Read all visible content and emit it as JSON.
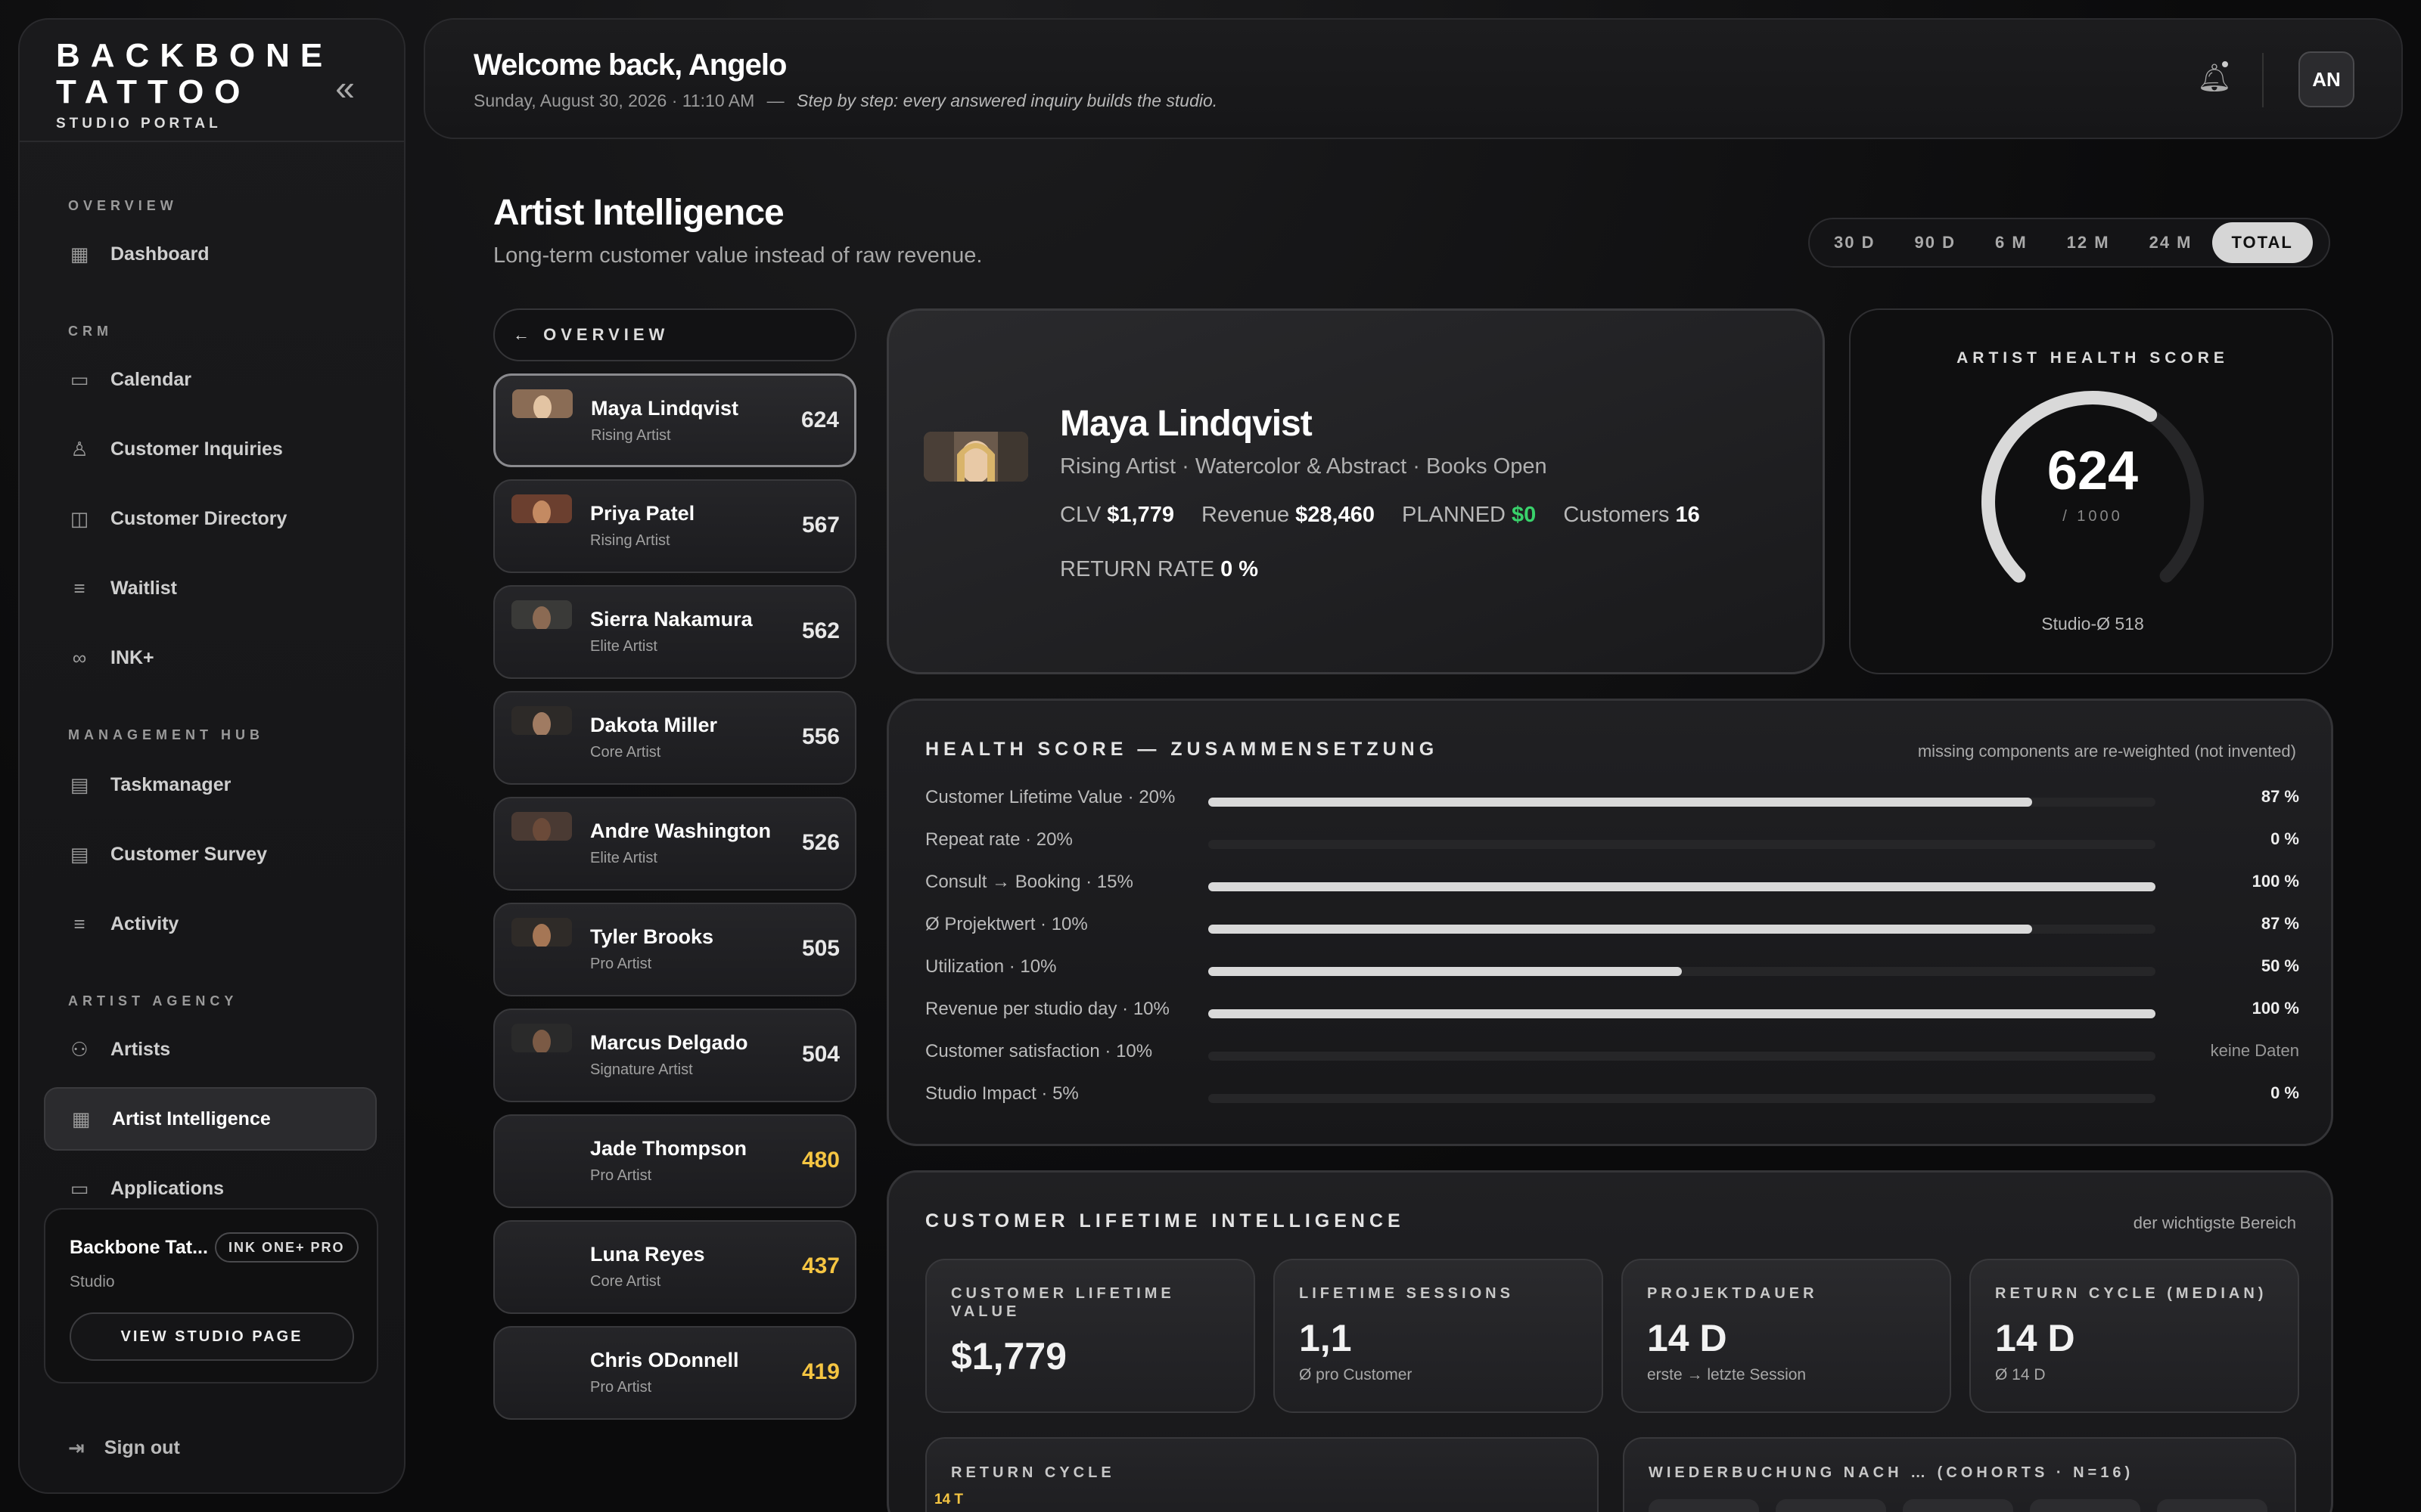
{
  "brand": {
    "line1": "BACKBONE",
    "line2": "TATTOO",
    "line3": "STUDIO PORTAL"
  },
  "sidebar": {
    "sections": [
      {
        "title": "OVERVIEW"
      },
      {
        "title": "CRM"
      },
      {
        "title": "MANAGEMENT HUB"
      },
      {
        "title": "ARTIST AGENCY"
      }
    ],
    "items": [
      {
        "label": "Dashboard",
        "icon": "grid-icon"
      },
      {
        "label": "Calendar",
        "icon": "calendar-icon"
      },
      {
        "label": "Customer Inquiries",
        "icon": "user-icon"
      },
      {
        "label": "Customer Directory",
        "icon": "book-icon"
      },
      {
        "label": "Waitlist",
        "icon": "list-icon"
      },
      {
        "label": "INK+",
        "icon": "link-icon"
      },
      {
        "label": "Taskmanager",
        "icon": "clipboard-icon"
      },
      {
        "label": "Customer Survey",
        "icon": "clipboard-icon"
      },
      {
        "label": "Activity",
        "icon": "list-icon"
      },
      {
        "label": "Artists",
        "icon": "users-icon"
      },
      {
        "label": "Artist Intelligence",
        "icon": "grid-icon"
      },
      {
        "label": "Applications",
        "icon": "calendar-icon"
      }
    ],
    "studio": {
      "name": "Backbone Tat...",
      "badge": "INK ONE+ PRO",
      "sub": "Studio",
      "button": "VIEW STUDIO PAGE"
    },
    "signout": "Sign out"
  },
  "header": {
    "welcome": "Welcome back, Angelo",
    "date": "Sunday, August 30, 2026 · 11:10 AM",
    "sep": "—",
    "motto": "Step by step: every answered inquiry builds the studio.",
    "avatar": "AN"
  },
  "page": {
    "title": "Artist Intelligence",
    "subtitle": "Long-term customer value instead of raw revenue.",
    "ranges": [
      "30 D",
      "90 D",
      "6 M",
      "12 M",
      "24 M",
      "TOTAL"
    ],
    "active_range": "TOTAL",
    "back_label": "← OVERVIEW"
  },
  "artists": [
    {
      "name": "Maya Lindqvist",
      "tier": "Rising Artist",
      "score": "624",
      "highlight": false
    },
    {
      "name": "Priya Patel",
      "tier": "Rising Artist",
      "score": "567",
      "highlight": false
    },
    {
      "name": "Sierra Nakamura",
      "tier": "Elite Artist",
      "score": "562",
      "highlight": false
    },
    {
      "name": "Dakota Miller",
      "tier": "Core Artist",
      "score": "556",
      "highlight": false
    },
    {
      "name": "Andre Washington",
      "tier": "Elite Artist",
      "score": "526",
      "highlight": false
    },
    {
      "name": "Tyler Brooks",
      "tier": "Pro Artist",
      "score": "505",
      "highlight": false
    },
    {
      "name": "Marcus Delgado",
      "tier": "Signature Artist",
      "score": "504",
      "highlight": false
    },
    {
      "name": "Jade Thompson",
      "tier": "Pro Artist",
      "score": "480",
      "highlight": true
    },
    {
      "name": "Luna Reyes",
      "tier": "Core Artist",
      "score": "437",
      "highlight": true
    },
    {
      "name": "Chris ODonnell",
      "tier": "Pro Artist",
      "score": "419",
      "highlight": true
    }
  ],
  "profile": {
    "name": "Maya Lindqvist",
    "role": "Rising Artist · Watercolor & Abstract · Books Open",
    "clv_label": "CLV",
    "clv": "$1,779",
    "revenue_label": "Revenue",
    "revenue": "$28,460",
    "planned_label": "PLANNED",
    "planned": "$0",
    "customers_label": "Customers",
    "customers": "16",
    "return_label": "RETURN RATE",
    "return": "0 %"
  },
  "health": {
    "title": "ARTIST HEALTH SCORE",
    "score": "624",
    "max": "/ 1000",
    "score_fraction": 0.624,
    "studio_avg": "Studio-Ø 518"
  },
  "composition": {
    "title": "HEALTH SCORE — ZUSAMMENSETZUNG",
    "note": "missing components are re-weighted (not invented)",
    "rows": [
      {
        "label": "Customer Lifetime Value · 20%",
        "value": "87 %",
        "pct": 87
      },
      {
        "label": "Repeat rate · 20%",
        "value": "0 %",
        "pct": 0
      },
      {
        "label": "Consult → Booking · 15%",
        "value": "100 %",
        "pct": 100
      },
      {
        "label": "Ø Projektwert · 10%",
        "value": "87 %",
        "pct": 87
      },
      {
        "label": "Utilization · 10%",
        "value": "50 %",
        "pct": 50
      },
      {
        "label": "Revenue per studio day · 10%",
        "value": "100 %",
        "pct": 100
      },
      {
        "label": "Customer satisfaction · 10%",
        "value": "keine Daten",
        "pct": 0
      },
      {
        "label": "Studio Impact · 5%",
        "value": "0 %",
        "pct": 0
      }
    ]
  },
  "cli": {
    "title": "CUSTOMER LIFETIME INTELLIGENCE",
    "note": "der wichtigste Bereich",
    "kpis": [
      {
        "label": "CUSTOMER LIFETIME VALUE",
        "value": "$1,779",
        "sub": ""
      },
      {
        "label": "LIFETIME SESSIONS",
        "value": "1,1",
        "sub": "Ø pro Customer"
      },
      {
        "label": "PROJEKTDAUER",
        "value": "14 D",
        "sub": "erste → letzte Session"
      },
      {
        "label": "RETURN CYCLE (MEDIAN)",
        "value": "14 D",
        "sub": "Ø 14 D"
      }
    ],
    "return_cycle": {
      "label": "RETURN CYCLE",
      "value": "14 T"
    },
    "rebooking": {
      "label": "WIEDERBUCHUNG NACH … (COHORTS · N=16)"
    }
  }
}
